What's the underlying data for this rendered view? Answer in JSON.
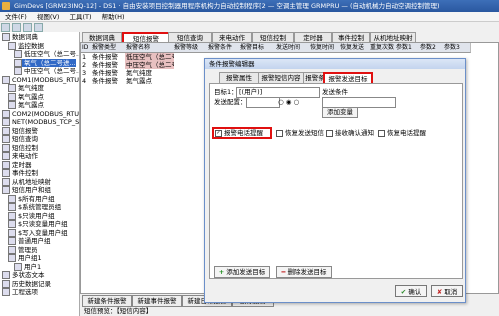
{
  "window": {
    "title": "GimDevs [GRM23INQ-12] - DS1 · 自由安装项目控制器用程序机构力自动控制程序[2 — 空调主管理 GRMPRU — (自动机械力自动空调控制管理)"
  },
  "menubar": [
    "文件(F)",
    "视图(V)",
    "工具(T)",
    "帮助(H)"
  ],
  "tree": [
    {
      "label": "数据词典",
      "selected": false
    },
    {
      "label": "监控数据",
      "selected": false
    },
    {
      "label": "低压空气（总二号...",
      "selected": false
    },
    {
      "label": "氧气（总二号进...",
      "selected": true
    },
    {
      "label": "中压空气（总二号...",
      "selected": false
    },
    {
      "label": "COM1(MODBUS_RTU)",
      "selected": false
    },
    {
      "label": "氮气纯度",
      "selected": false
    },
    {
      "label": "氧气露点",
      "selected": false
    },
    {
      "label": "氮气露点",
      "selected": false
    },
    {
      "label": "COM2(MODBUS_RTU_SERV",
      "selected": false
    },
    {
      "label": "NET(MODBUS_TCP_SERV",
      "selected": false
    },
    {
      "label": "短信报警",
      "selected": false
    },
    {
      "label": "短信查询",
      "selected": false
    },
    {
      "label": "短信控制",
      "selected": false
    },
    {
      "label": "来电动作",
      "selected": false
    },
    {
      "label": "定时器",
      "selected": false
    },
    {
      "label": "事件控制",
      "selected": false
    },
    {
      "label": "从机地址映射",
      "selected": false
    },
    {
      "label": "短信用户和组",
      "selected": false
    },
    {
      "label": "$所有用户组",
      "selected": false
    },
    {
      "label": "$系统管理员组",
      "selected": false
    },
    {
      "label": "$只读用户组",
      "selected": false
    },
    {
      "label": "$只读变量用户组",
      "selected": false
    },
    {
      "label": "$写入变量用户组",
      "selected": false
    },
    {
      "label": "普通用户组",
      "selected": false
    },
    {
      "label": "管理员",
      "selected": false
    },
    {
      "label": "用户组1",
      "selected": false
    },
    {
      "label": "用户1",
      "selected": false
    },
    {
      "label": "多状态文本",
      "selected": false
    },
    {
      "label": "历史数据记录",
      "selected": false
    },
    {
      "label": "工程选项",
      "selected": false
    }
  ],
  "tabs": [
    "数据词典",
    "短信报警",
    "短信查询",
    "来电动作",
    "短信控制",
    "定时器",
    "事件控制",
    "从机地址映射"
  ],
  "table": {
    "headers": [
      "ID",
      "报警类型",
      "报警名称",
      "报警等级",
      "报警条件",
      "报警目标",
      "发送时间",
      "恢复时间",
      "恢复发送",
      "重复次数",
      "参数1",
      "参数2",
      "参数3"
    ],
    "rows": [
      [
        "1",
        "条件报警",
        "低压空气（总二号...",
        "",
        "",
        "",
        "",
        "",
        "",
        "",
        "",
        "",
        ""
      ],
      [
        "2",
        "条件报警",
        "中压空气（总二号...",
        "",
        "",
        "",
        "",
        "",
        "",
        "",
        "",
        "",
        ""
      ],
      [
        "3",
        "条件报警",
        "氮气纯度",
        "",
        "",
        "",
        "",
        "",
        "",
        "",
        "",
        "",
        ""
      ],
      [
        "4",
        "条件报警",
        "氮气露点",
        "",
        "",
        "",
        "",
        "",
        "",
        "",
        "",
        "",
        ""
      ]
    ]
  },
  "bottom_buttons": [
    "新建条件报警",
    "新建事件报警",
    "新建日常报警",
    "删除报警"
  ],
  "status_line": "短信预览：【短信内容】",
  "dialog": {
    "title": "条件报警编辑器",
    "tabs": [
      "报警属性",
      "报警短信内容",
      "报警条件",
      "报警发送目标"
    ],
    "target_label": "目标1：",
    "target_value": "[(用户)]",
    "send_cond_label": "发送条件",
    "add_var_button": "添加变量",
    "send_config_label": "发送配置：",
    "checks": [
      {
        "label": "报警电话提醒",
        "checked": true
      },
      {
        "label": "恢复发送短信",
        "checked": false
      },
      {
        "label": "接收确认通知",
        "checked": false
      },
      {
        "label": "恢复电话提醒",
        "checked": false
      }
    ],
    "add_target_button": "添加发送目标",
    "del_target_button": "删除发送目标",
    "ok_button": "确认",
    "cancel_button": "取消"
  }
}
